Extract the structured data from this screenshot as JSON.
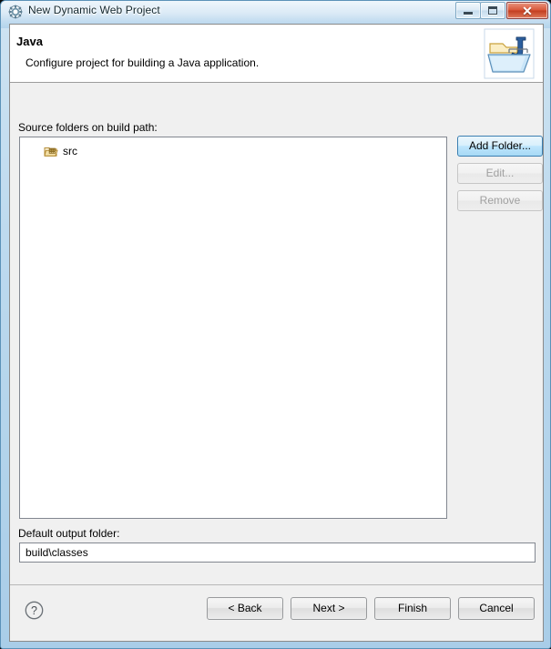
{
  "window": {
    "title": "New Dynamic Web Project",
    "icon": "wizard-gear-icon",
    "controls": {
      "minimize_label": "Minimize",
      "maximize_label": "Maximize",
      "close_label": "Close"
    }
  },
  "banner": {
    "title": "Java",
    "description": "Configure project for building a Java application.",
    "icon": "java-folder-banner-icon"
  },
  "content": {
    "source_folders_label": "Source folders on build path:",
    "source_folders": [
      {
        "icon": "source-folder-icon",
        "label": "src"
      }
    ],
    "side_buttons": [
      {
        "label": "Add Folder...",
        "enabled": true,
        "name": "add-folder-button"
      },
      {
        "label": "Edit...",
        "enabled": false,
        "name": "edit-button"
      },
      {
        "label": "Remove",
        "enabled": false,
        "name": "remove-button"
      }
    ],
    "output_folder_label": "Default output folder:",
    "output_folder_value": "build\\classes",
    "output_folder_placeholder": ""
  },
  "footer": {
    "help_icon": "help-question-icon",
    "buttons": [
      {
        "label": "< Back",
        "name": "back-button"
      },
      {
        "label": "Next >",
        "name": "next-button"
      },
      {
        "label": "Finish",
        "name": "finish-button"
      },
      {
        "label": "Cancel",
        "name": "cancel-button"
      }
    ]
  },
  "colors": {
    "accent_blue": "#3c7fb1",
    "window_chrome": "#bcd9ee",
    "dialog_bg": "#f0f0f0",
    "close_red": "#c23d20",
    "folder_tan": "#e9c37a"
  }
}
